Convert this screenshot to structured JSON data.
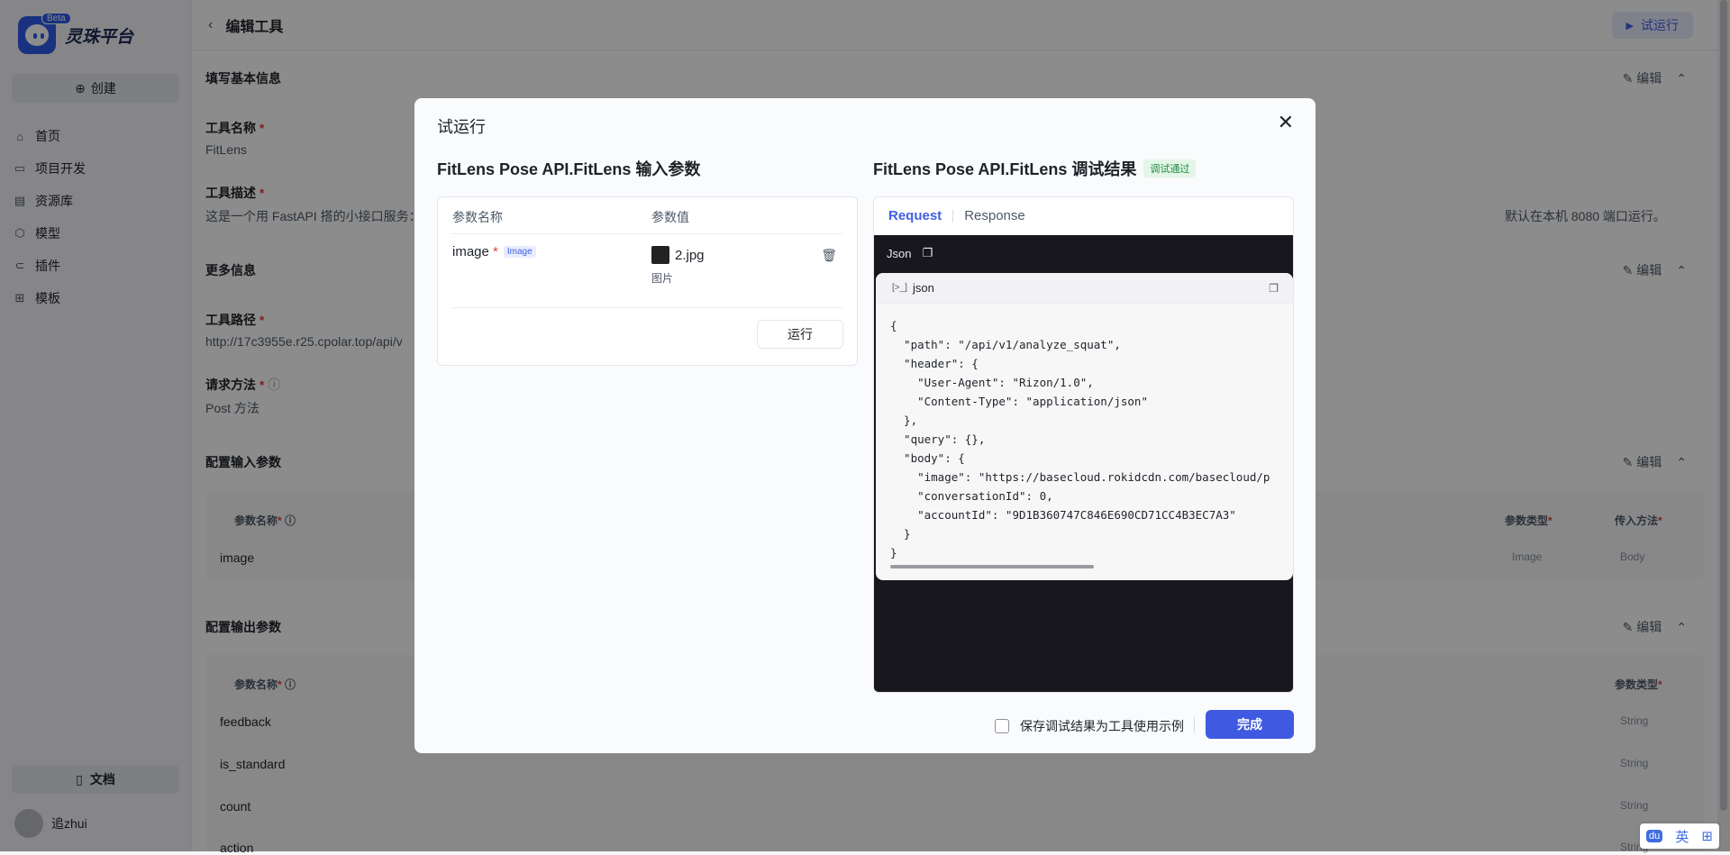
{
  "app": {
    "name": "灵珠平台",
    "beta": "Beta"
  },
  "sidebar": {
    "create_label": "创建",
    "items": [
      {
        "label": "首页",
        "icon": "home-icon"
      },
      {
        "label": "项目开发",
        "icon": "project-icon"
      },
      {
        "label": "资源库",
        "icon": "library-icon"
      },
      {
        "label": "模型",
        "icon": "model-icon"
      },
      {
        "label": "插件",
        "icon": "plugin-icon"
      },
      {
        "label": "模板",
        "icon": "template-icon"
      }
    ],
    "doc_label": "文档",
    "user_name": "追zhui"
  },
  "header": {
    "title": "编辑工具",
    "run_label": "试运行"
  },
  "sections": {
    "basic": "填写基本信息",
    "more": "更多信息",
    "input": "配置输入参数",
    "output": "配置输出参数",
    "edit_label": "编辑"
  },
  "basic": {
    "name_label": "工具名称",
    "name_value": "FitLens",
    "desc_label": "工具描述",
    "desc_value": "这是一个用 FastAPI 搭的小接口服务：",
    "desc_tail": "默认在本机 8080 端口运行。"
  },
  "more": {
    "path_label": "工具路径",
    "path_value": "http://17c3955e.r25.cpolar.top/api/v",
    "method_label": "请求方法",
    "method_value": "Post 方法"
  },
  "input_table": {
    "headers": {
      "name": "参数名称",
      "type": "参数类型",
      "method": "传入方法"
    },
    "rows": [
      {
        "name": "image",
        "type": "Image",
        "method": "Body"
      }
    ]
  },
  "output_table": {
    "headers": {
      "name": "参数名称",
      "type": "参数类型"
    },
    "rows": [
      {
        "name": "feedback",
        "type": "String"
      },
      {
        "name": "is_standard",
        "type": "String"
      },
      {
        "name": "count",
        "type": "String"
      },
      {
        "name": "action",
        "type": "String"
      }
    ]
  },
  "modal": {
    "title": "试运行",
    "input_title": "FitLens Pose API.FitLens 输入参数",
    "result_title": "FitLens Pose API.FitLens 调试结果",
    "pass_badge": "调试通过",
    "col_name": "参数名称",
    "col_value": "参数值",
    "param_name": "image",
    "param_tag": "Image",
    "file_name": "2.jpg",
    "file_type": "图片",
    "run_label": "运行",
    "tabs": [
      "Request",
      "Response"
    ],
    "json_label": "Json",
    "code_label": "json",
    "code": "{\n  \"path\": \"/api/v1/analyze_squat\",\n  \"header\": {\n    \"User-Agent\": \"Rizon/1.0\",\n    \"Content-Type\": \"application/json\"\n  },\n  \"query\": {},\n  \"body\": {\n    \"image\": \"https://basecloud.rokidcdn.com/basecloud/p\n    \"conversationId\": 0,\n    \"accountId\": \"9D1B360747C846E690CD71CC4B3EC7A3\"\n  }\n}",
    "save_example_label": "保存调试结果为工具使用示例",
    "done_label": "完成"
  },
  "widget": {
    "lang": "英",
    "grid": "⊞"
  }
}
